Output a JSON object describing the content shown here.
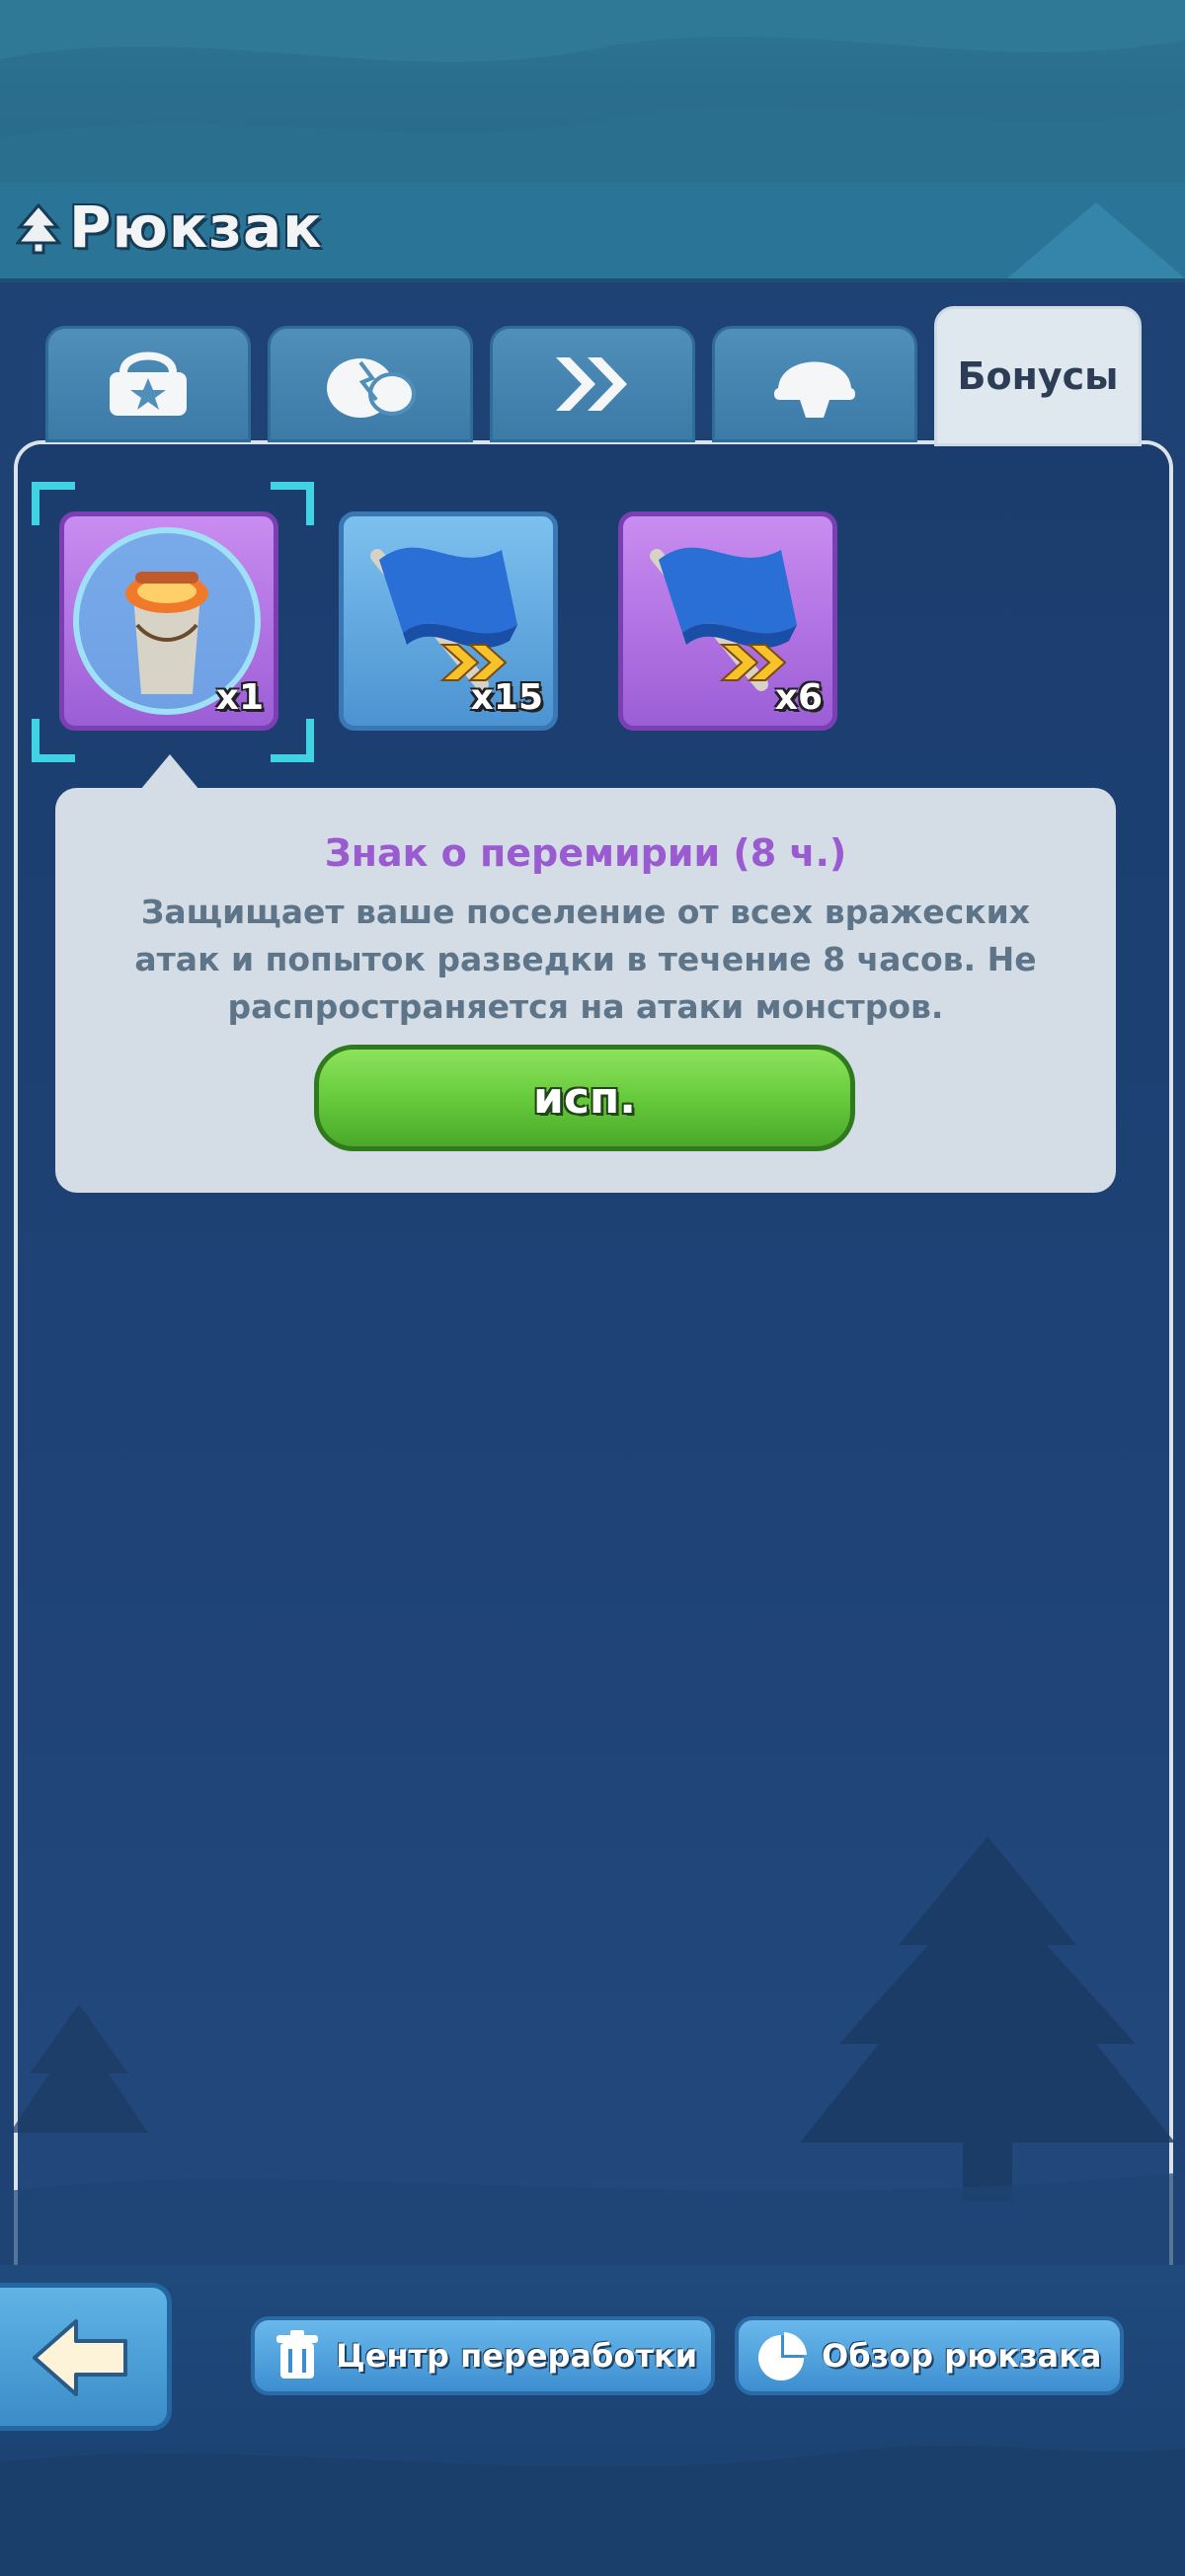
{
  "header": {
    "title": "Рюкзак"
  },
  "tabs": [
    {
      "icon": "chest-star-icon",
      "label": ""
    },
    {
      "icon": "resources-icon",
      "label": ""
    },
    {
      "icon": "speedup-chevrons-icon",
      "label": ""
    },
    {
      "icon": "helmet-icon",
      "label": ""
    },
    {
      "icon": "",
      "label": "Бонусы",
      "active": true
    }
  ],
  "items": [
    {
      "name": "truce-sign",
      "icon": "truce-jar-icon",
      "quantity": "x1",
      "rarity": "purple",
      "selected": true
    },
    {
      "name": "march-speedup-blue",
      "icon": "blue-flag-icon",
      "quantity": "x15",
      "rarity": "blue"
    },
    {
      "name": "march-speedup-purple",
      "icon": "blue-flag-icon",
      "quantity": "x6",
      "rarity": "purple"
    }
  ],
  "tooltip": {
    "title": "Знак о перемирии (8 ч.)",
    "description": "Защищает ваше поселение от всех вражеских атак и попыток разведки в течение 8 часов. Не распространяется на атаки монстров.",
    "use_label": "исп."
  },
  "footer": {
    "back_icon": "arrow-left-icon",
    "recycle_label": "Центр переработки",
    "recycle_icon": "trash-icon",
    "overview_label": "Обзор рюкзака",
    "overview_icon": "pie-chart-icon"
  },
  "colors": {
    "accent_purple": "#9a5bd1",
    "button_green": "#63c83a",
    "panel_bg": "#1f4275"
  }
}
